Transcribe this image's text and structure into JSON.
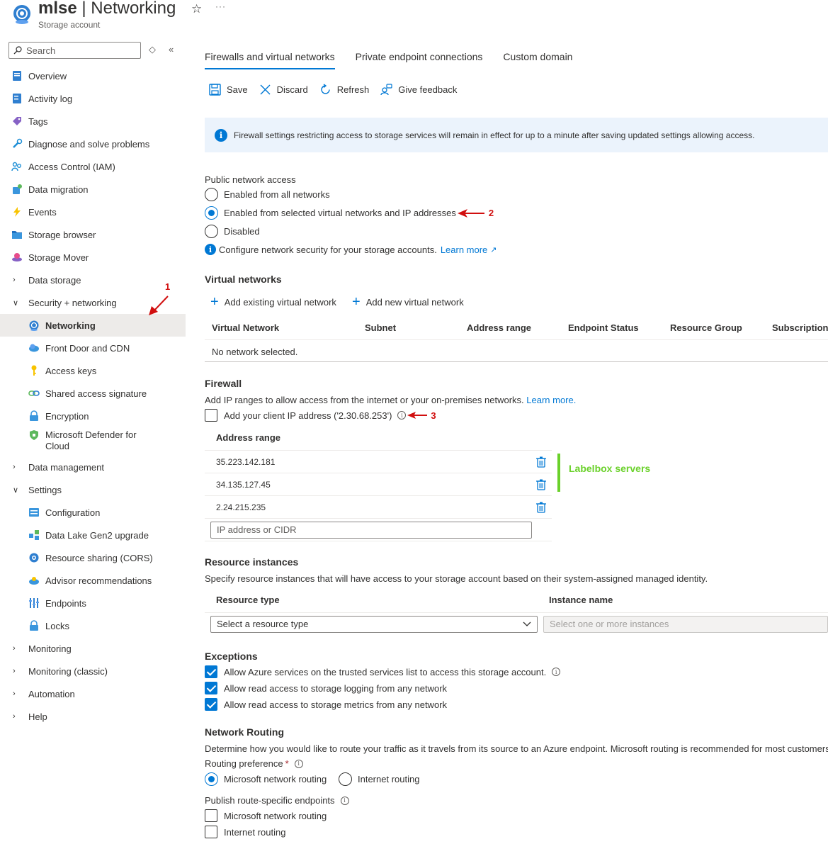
{
  "header": {
    "resource_name": "mlse",
    "separator": " | ",
    "page_name": "Networking",
    "subtitle": "Storage account",
    "more": "···"
  },
  "sidebar": {
    "search_placeholder": "Search",
    "items": [
      {
        "label": "Overview",
        "icon": "overview-icon",
        "kind": "top"
      },
      {
        "label": "Activity log",
        "icon": "activity-log-icon",
        "kind": "top"
      },
      {
        "label": "Tags",
        "icon": "tag-icon",
        "kind": "top"
      },
      {
        "label": "Diagnose and solve problems",
        "icon": "wrench-icon",
        "kind": "top"
      },
      {
        "label": "Access Control (IAM)",
        "icon": "people-icon",
        "kind": "top"
      },
      {
        "label": "Data migration",
        "icon": "migration-icon",
        "kind": "top"
      },
      {
        "label": "Events",
        "icon": "lightning-icon",
        "kind": "top"
      },
      {
        "label": "Storage browser",
        "icon": "folder-icon",
        "kind": "top"
      },
      {
        "label": "Storage Mover",
        "icon": "mover-icon",
        "kind": "top"
      },
      {
        "label": "Data storage",
        "kind": "group",
        "expanded": false
      },
      {
        "label": "Security + networking",
        "kind": "group",
        "expanded": true
      },
      {
        "label": "Networking",
        "icon": "networking-icon",
        "kind": "sub",
        "active": true
      },
      {
        "label": "Front Door and CDN",
        "icon": "cloud-icon",
        "kind": "sub"
      },
      {
        "label": "Access keys",
        "icon": "key-icon",
        "kind": "sub"
      },
      {
        "label": "Shared access signature",
        "icon": "link-icon",
        "kind": "sub"
      },
      {
        "label": "Encryption",
        "icon": "lock-icon",
        "kind": "sub"
      },
      {
        "label": "Microsoft Defender for Cloud",
        "icon": "shield-icon",
        "kind": "sub"
      },
      {
        "label": "Data management",
        "kind": "group",
        "expanded": false
      },
      {
        "label": "Settings",
        "kind": "group",
        "expanded": true
      },
      {
        "label": "Configuration",
        "icon": "configuration-icon",
        "kind": "sub"
      },
      {
        "label": "Data Lake Gen2 upgrade",
        "icon": "upgrade-icon",
        "kind": "sub"
      },
      {
        "label": "Resource sharing (CORS)",
        "icon": "cors-icon",
        "kind": "sub"
      },
      {
        "label": "Advisor recommendations",
        "icon": "advisor-icon",
        "kind": "sub"
      },
      {
        "label": "Endpoints",
        "icon": "endpoints-icon",
        "kind": "sub"
      },
      {
        "label": "Locks",
        "icon": "lock-icon",
        "kind": "sub"
      },
      {
        "label": "Monitoring",
        "kind": "group",
        "expanded": false
      },
      {
        "label": "Monitoring (classic)",
        "kind": "group",
        "expanded": false
      },
      {
        "label": "Automation",
        "kind": "group",
        "expanded": false
      },
      {
        "label": "Help",
        "kind": "group",
        "expanded": false
      }
    ]
  },
  "tabs": [
    "Firewalls and virtual networks",
    "Private endpoint connections",
    "Custom domain"
  ],
  "toolbar": {
    "save": "Save",
    "discard": "Discard",
    "refresh": "Refresh",
    "feedback": "Give feedback"
  },
  "info_banner": "Firewall settings restricting access to storage services will remain in effect for up to a minute after saving updated settings allowing access.",
  "public_access": {
    "label": "Public network access",
    "options": [
      "Enabled from all networks",
      "Enabled from selected virtual networks and IP addresses",
      "Disabled"
    ],
    "selected": 1,
    "hint": "Configure network security for your storage accounts.",
    "learn_more": "Learn more"
  },
  "virtual_networks": {
    "title": "Virtual networks",
    "add_existing": "Add existing virtual network",
    "add_new": "Add new virtual network",
    "columns": [
      "Virtual Network",
      "Subnet",
      "Address range",
      "Endpoint Status",
      "Resource Group",
      "Subscription"
    ],
    "empty": "No network selected."
  },
  "firewall": {
    "title": "Firewall",
    "desc": "Add IP ranges to allow access from the internet or your on-premises networks.",
    "learn_more": "Learn more.",
    "client_ip": "Add your client IP address ('2.30.68.253')",
    "column": "Address range",
    "ranges": [
      "35.223.142.181",
      "34.135.127.45",
      "2.24.215.235"
    ],
    "input_placeholder": "IP address or CIDR"
  },
  "resource_instances": {
    "title": "Resource instances",
    "desc": "Specify resource instances that will have access to your storage account based on their system-assigned managed identity.",
    "col_type": "Resource type",
    "col_name": "Instance name",
    "type_placeholder": "Select a resource type",
    "name_placeholder": "Select one or more instances"
  },
  "exceptions": {
    "title": "Exceptions",
    "items": [
      "Allow Azure services on the trusted services list to access this storage account.",
      "Allow read access to storage logging from any network",
      "Allow read access to storage metrics from any network"
    ]
  },
  "routing": {
    "title": "Network Routing",
    "desc": "Determine how you would like to route your traffic as it travels from its source to an Azure endpoint. Microsoft routing is recommended for most customers.",
    "pref_label": "Routing preference",
    "required": "*",
    "options": [
      "Microsoft network routing",
      "Internet routing"
    ],
    "publish_label": "Publish route-specific endpoints",
    "publish_options": [
      "Microsoft network routing",
      "Internet routing"
    ]
  },
  "annotations": {
    "step1": "1",
    "step2": "2",
    "step3": "3",
    "labelbox": "Labelbox servers",
    "arrow_color": "#d10f0f",
    "labelbox_color": "#6ad12a"
  },
  "colors": {
    "accent": "#0078d4",
    "banner_bg": "#ebf3fc",
    "active_nav_bg": "#edebe9"
  }
}
